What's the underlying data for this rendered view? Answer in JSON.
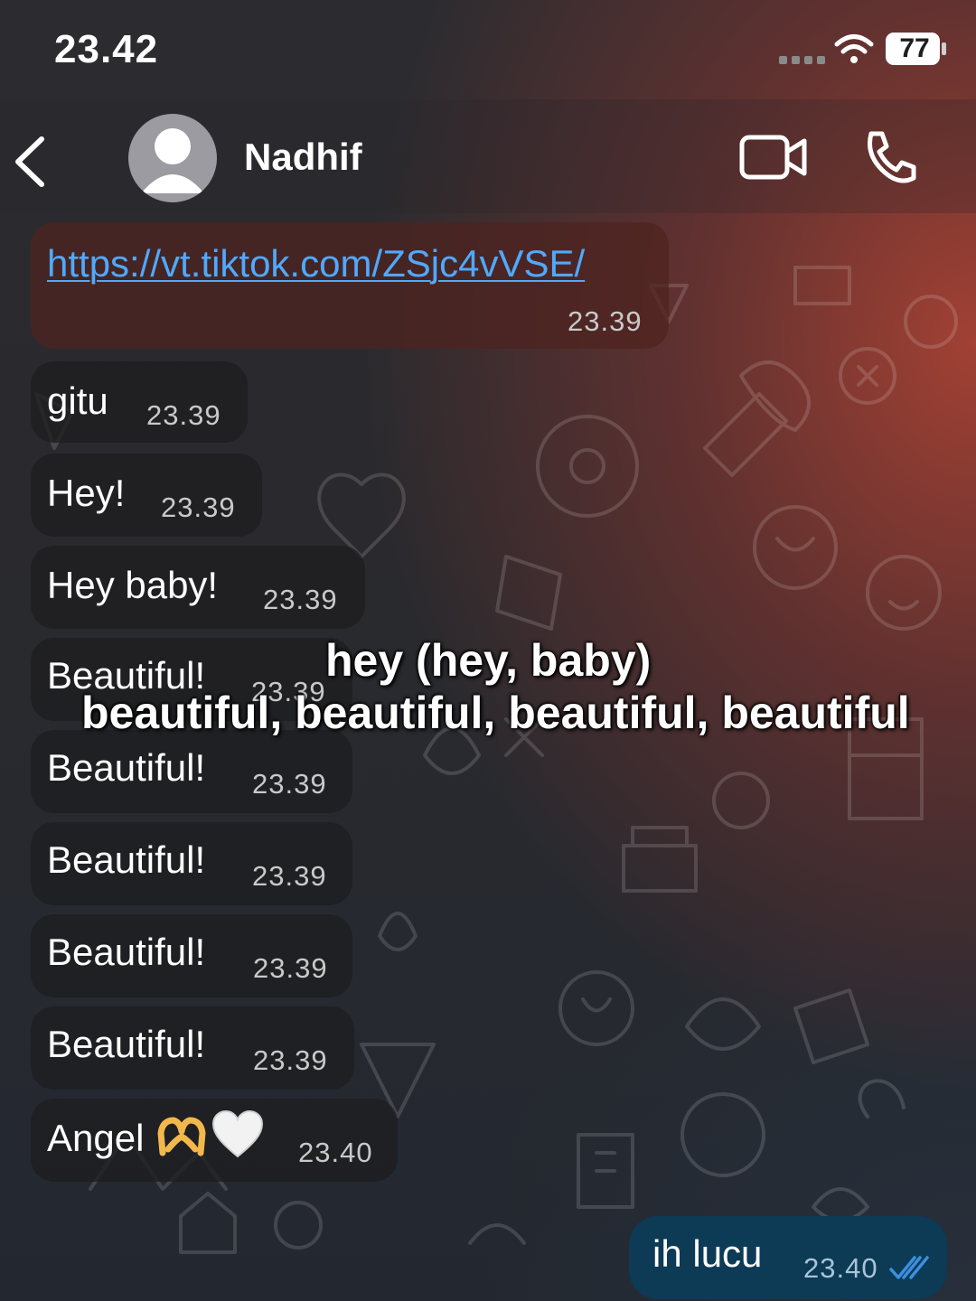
{
  "status_bar": {
    "time": "23.42",
    "battery": "77"
  },
  "header": {
    "contact_name": "Nadhif"
  },
  "messages": [
    {
      "text": "https://vt.tiktok.com/ZSjc4vVSE/",
      "time": "23.39",
      "is_link": true
    },
    {
      "text": "gitu",
      "time": "23.39"
    },
    {
      "text": "Hey!",
      "time": "23.39"
    },
    {
      "text": "Hey baby!",
      "time": "23.39"
    },
    {
      "text": "Beautiful!",
      "time": "23.39"
    },
    {
      "text": "Beautiful!",
      "time": "23.39"
    },
    {
      "text": "Beautiful!",
      "time": "23.39"
    },
    {
      "text": "Beautiful!",
      "time": "23.39"
    },
    {
      "text": "Beautiful!",
      "time": "23.39"
    },
    {
      "text": "Angel",
      "time": "23.40",
      "emoji": [
        "🫶",
        "🤍"
      ]
    }
  ],
  "outgoing": {
    "text": "ih lucu",
    "time": "23.40",
    "status": "read"
  },
  "caption": {
    "line1": "hey (hey, baby)",
    "line2": "beautiful, beautiful, beautiful, beautiful"
  },
  "colors": {
    "link": "#4fa9ff",
    "outgoing_bubble": "#0d3a55",
    "read_ticks": "#3b8fe0"
  }
}
